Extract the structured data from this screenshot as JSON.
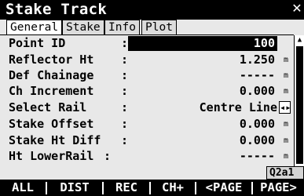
{
  "title": "Stake Track",
  "close_glyph": "✕",
  "tabs": [
    "General",
    "Stake",
    "Info",
    "Plot"
  ],
  "rows": [
    {
      "label": "Point ID",
      "value": "100",
      "unit": ""
    },
    {
      "label": "Reflector Ht",
      "value": "1.250",
      "unit": "m"
    },
    {
      "label": "Def Chainage",
      "value": "-----",
      "unit": "m"
    },
    {
      "label": "Ch Increment",
      "value": "0.000",
      "unit": "m"
    },
    {
      "label": "Select Rail",
      "value": "Centre Line",
      "unit": ""
    },
    {
      "label": "Stake Offset",
      "value": "0.000",
      "unit": "m"
    },
    {
      "label": "Stake Ht Diff",
      "value": "0.000",
      "unit": "m"
    },
    {
      "label": "Ht LowerRail",
      "value": "-----",
      "unit": "m"
    }
  ],
  "colon": ":",
  "status_text": "Q2a1",
  "softkeys": [
    "ALL",
    "DIST",
    "REC",
    "CH+",
    "<PAGE",
    "PAGE>"
  ]
}
